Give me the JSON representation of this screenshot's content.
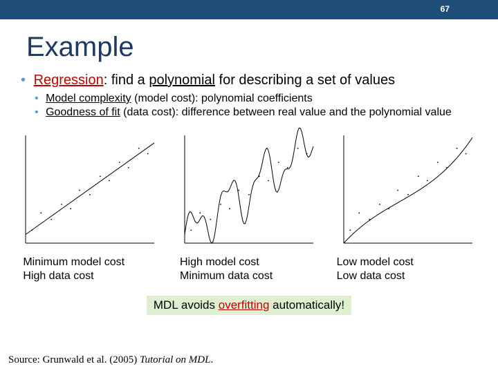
{
  "page_number": "67",
  "title": "Example",
  "main_bullet": {
    "regression": "Regression",
    "rest": ": find a ",
    "polynomial": "polynomial",
    "tail": " for describing a set of values"
  },
  "sub_bullets": [
    {
      "label": "Model complexity",
      "paren": " (model cost): polynomial coefficients"
    },
    {
      "label": "Goodness of fit",
      "paren": " (data cost): difference between real value and the polynomial value"
    }
  ],
  "captions": [
    {
      "line1": "Minimum model cost",
      "line2": "High data cost"
    },
    {
      "line1": "High model cost",
      "line2": "Minimum data cost"
    },
    {
      "line1": "Low model cost",
      "line2": "Low data cost"
    }
  ],
  "highlight": {
    "pre": "MDL avoids ",
    "word": "overfitting",
    "post": " automatically!"
  },
  "source": {
    "pre": "Source: Grunwald et al. (2005) ",
    "italic": "Tutorial on MDL",
    "post": "."
  },
  "chart_data": [
    {
      "type": "scatter",
      "title": "Linear fit (underfit)",
      "x_range": [
        0,
        10
      ],
      "y_range": [
        0,
        10
      ],
      "points": [
        {
          "x": 0.5,
          "y": 1.2
        },
        {
          "x": 1.2,
          "y": 2.8
        },
        {
          "x": 2.0,
          "y": 2.2
        },
        {
          "x": 2.8,
          "y": 3.6
        },
        {
          "x": 3.5,
          "y": 3.2
        },
        {
          "x": 4.2,
          "y": 4.9
        },
        {
          "x": 5.0,
          "y": 4.5
        },
        {
          "x": 5.8,
          "y": 6.2
        },
        {
          "x": 6.5,
          "y": 5.8
        },
        {
          "x": 7.3,
          "y": 7.5
        },
        {
          "x": 8.0,
          "y": 7.0
        },
        {
          "x": 8.8,
          "y": 8.8
        },
        {
          "x": 9.5,
          "y": 8.3
        }
      ],
      "fit": {
        "kind": "line",
        "m": 0.85,
        "b": 0.8
      }
    },
    {
      "type": "scatter",
      "title": "High-degree polynomial (overfit)",
      "x_range": [
        0,
        10
      ],
      "y_range": [
        0,
        10
      ],
      "points": [
        {
          "x": 0.5,
          "y": 1.2
        },
        {
          "x": 1.2,
          "y": 2.8
        },
        {
          "x": 2.0,
          "y": 2.2
        },
        {
          "x": 2.8,
          "y": 3.6
        },
        {
          "x": 3.5,
          "y": 3.2
        },
        {
          "x": 4.2,
          "y": 4.9
        },
        {
          "x": 5.0,
          "y": 4.5
        },
        {
          "x": 5.8,
          "y": 6.2
        },
        {
          "x": 6.5,
          "y": 5.8
        },
        {
          "x": 7.3,
          "y": 7.5
        },
        {
          "x": 8.0,
          "y": 7.0
        },
        {
          "x": 8.8,
          "y": 8.8
        },
        {
          "x": 9.5,
          "y": 8.3
        }
      ],
      "fit": {
        "kind": "wiggly"
      }
    },
    {
      "type": "scatter",
      "title": "Low-degree polynomial (good fit)",
      "x_range": [
        0,
        10
      ],
      "y_range": [
        0,
        10
      ],
      "points": [
        {
          "x": 0.5,
          "y": 1.2
        },
        {
          "x": 1.2,
          "y": 2.8
        },
        {
          "x": 2.0,
          "y": 2.2
        },
        {
          "x": 2.8,
          "y": 3.6
        },
        {
          "x": 3.5,
          "y": 3.2
        },
        {
          "x": 4.2,
          "y": 4.9
        },
        {
          "x": 5.0,
          "y": 4.5
        },
        {
          "x": 5.8,
          "y": 6.2
        },
        {
          "x": 6.5,
          "y": 5.8
        },
        {
          "x": 7.3,
          "y": 7.5
        },
        {
          "x": 8.0,
          "y": 7.0
        },
        {
          "x": 8.8,
          "y": 8.8
        },
        {
          "x": 9.5,
          "y": 8.3
        }
      ],
      "fit": {
        "kind": "cubic"
      }
    }
  ]
}
